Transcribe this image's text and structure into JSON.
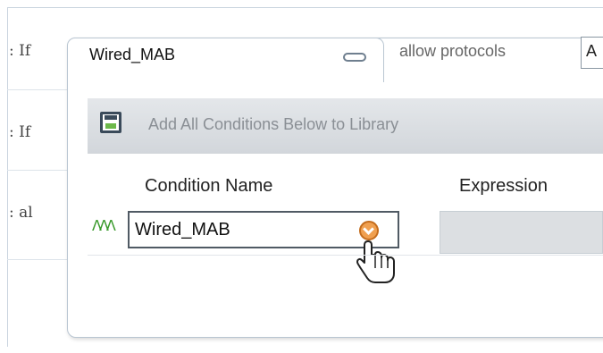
{
  "rows": [
    {
      "label": ": If"
    },
    {
      "label": ": If"
    },
    {
      "label": ":   al"
    }
  ],
  "popup": {
    "tab_title": "Wired_MAB",
    "collapse_icon": "collapse-pill-icon",
    "protocols_label": "allow protocols",
    "protocols_value": "A"
  },
  "toolbar": {
    "save_icon": "save-disk-icon",
    "add_label": "Add All Conditions Below to Library"
  },
  "table": {
    "headers": {
      "condition_name": "Condition Name",
      "expression": "Expression"
    },
    "row": {
      "condition_icon": "condition-grass-icon",
      "condition_value": "Wired_MAB",
      "dropdown_icon": "chevron-down-icon",
      "expression_value": ""
    }
  },
  "colors": {
    "accent_orange": "#f0a050",
    "toolbar_bg": "#d8dce0",
    "condition_green": "#3a9a2c"
  }
}
